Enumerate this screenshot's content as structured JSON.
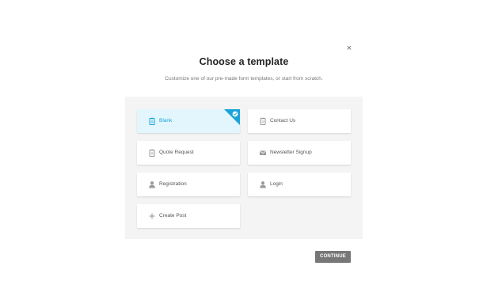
{
  "modal": {
    "close_glyph": "×",
    "title": "Choose a template",
    "subtitle": "Customize one of our pre-made form templates, or start from scratch.",
    "continue_label": "CONTINUE"
  },
  "templates": [
    {
      "label": "Blank",
      "icon": "clipboard-icon",
      "selected": true
    },
    {
      "label": "Contact Us",
      "icon": "clipboard-icon",
      "selected": false
    },
    {
      "label": "Quote Request",
      "icon": "clipboard-icon",
      "selected": false
    },
    {
      "label": "Newsletter Signup",
      "icon": "envelope-icon",
      "selected": false
    },
    {
      "label": "Registration",
      "icon": "user-icon",
      "selected": false
    },
    {
      "label": "Login",
      "icon": "user-icon",
      "selected": false
    },
    {
      "label": "Create Post",
      "icon": "plus-icon",
      "selected": false
    }
  ],
  "colors": {
    "accent": "#1aa3d8",
    "selected_bg": "#e3f6fd",
    "panel_bg": "#f4f4f4",
    "button_bg": "#777777",
    "icon_gray": "#9a9a9a"
  }
}
